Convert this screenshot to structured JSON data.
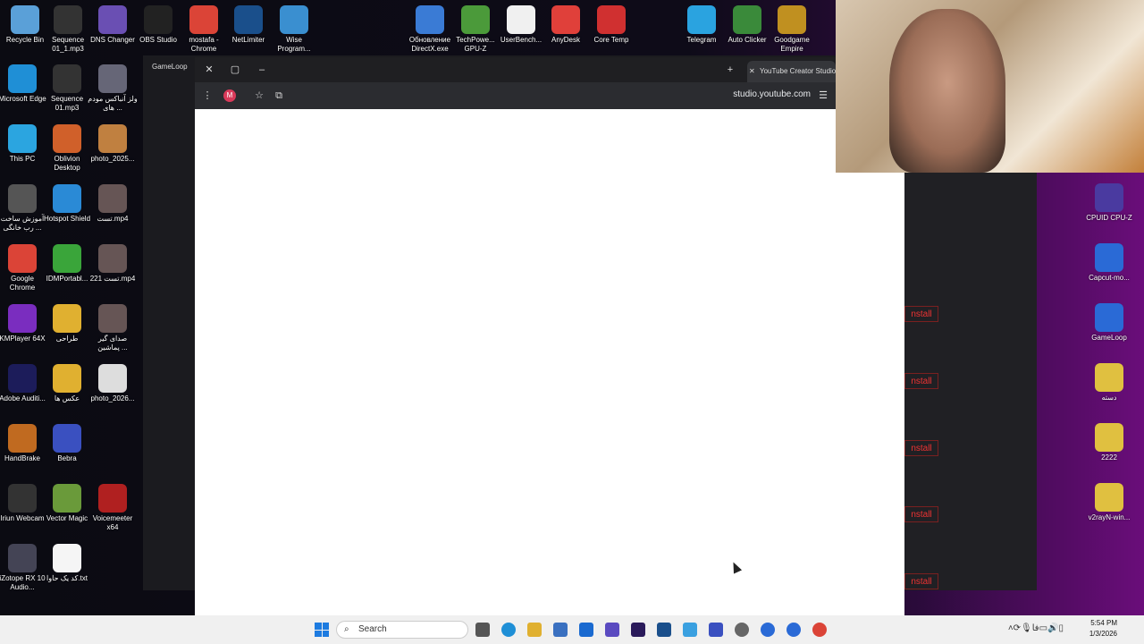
{
  "desktop_icons_left": [
    {
      "label": "Recycle Bin",
      "x": 0,
      "y": 0,
      "color": "#5aa0d8",
      "icon": "recycle-bin-icon"
    },
    {
      "label": "Sequence 01_1.mp3",
      "color": "#333",
      "icon": "media-file-icon"
    },
    {
      "label": "DNS Changer",
      "color": "#6a4fb3",
      "icon": "dns-icon"
    },
    {
      "label": "OBS Studio",
      "color": "#222",
      "icon": "obs-icon"
    },
    {
      "label": "mostafa - Chrome",
      "color": "#db4437",
      "icon": "chrome-icon"
    },
    {
      "label": "NetLimiter",
      "color": "#1a4f8b",
      "icon": "netlimiter-icon"
    },
    {
      "label": "Wise Program...",
      "color": "#3a8fd0",
      "icon": "wise-icon"
    }
  ],
  "desktop_icons_top_middle": [
    {
      "label": "Обновление DirectX.exe",
      "color": "#3a7bd5",
      "icon": "directx-icon"
    },
    {
      "label": "TechPowe... GPU-Z",
      "color": "#4b9a3a",
      "icon": "gpuz-icon"
    },
    {
      "label": "UserBench...",
      "color": "#f0f0f0",
      "icon": "userbench-icon"
    },
    {
      "label": "AnyDesk",
      "color": "#e0403a",
      "icon": "anydesk-icon"
    },
    {
      "label": "Core Temp",
      "color": "#d03030",
      "icon": "coretemp-icon"
    },
    {
      "label": "Telegram",
      "color": "#2aa3e0",
      "icon": "telegram-icon"
    },
    {
      "label": "Auto Clicker",
      "color": "#3a8a3a",
      "icon": "autoclicker-icon"
    },
    {
      "label": "Goodgame Empire",
      "color": "#c09020",
      "icon": "goodgame-icon"
    }
  ],
  "desktop_col1": [
    {
      "label": "Microsoft Edge",
      "color": "#1f8fd6",
      "icon": "edge-icon"
    },
    {
      "label": "This PC",
      "color": "#2ba5e0",
      "icon": "this-pc-icon"
    },
    {
      "label": "آموزش ساخت رب خانگی ...",
      "color": "#555",
      "icon": "video-file-icon"
    },
    {
      "label": "Google Chrome",
      "color": "#db4437",
      "icon": "chrome-icon"
    },
    {
      "label": "KMPlayer 64X",
      "color": "#7a2dbf",
      "icon": "kmplayer-icon"
    },
    {
      "label": "Adobe Auditi...",
      "color": "#1c1c5a",
      "icon": "audition-icon"
    },
    {
      "label": "HandBrake",
      "color": "#c06a20",
      "icon": "handbrake-icon"
    },
    {
      "label": "Iriun Webcam",
      "color": "#333",
      "icon": "iriun-icon"
    },
    {
      "label": "iZotope RX 10 Audio...",
      "color": "#445",
      "icon": "izotope-icon"
    }
  ],
  "desktop_col2": [
    {
      "label": "Sequence 01.mp3",
      "color": "#333",
      "icon": "media-file-icon"
    },
    {
      "label": "Oblivion Desktop",
      "color": "#d0602a",
      "icon": "oblivion-icon"
    },
    {
      "label": "Hotspot Shield",
      "color": "#2a8ad6",
      "icon": "hotspot-icon"
    },
    {
      "label": "IDMPortabl...",
      "color": "#3aa53a",
      "icon": "idm-icon"
    },
    {
      "label": "طراحی",
      "color": "#e0b030",
      "icon": "folder-icon"
    },
    {
      "label": "عکس ها",
      "color": "#e0b030",
      "icon": "folder-icon"
    },
    {
      "label": "Bebra",
      "color": "#3a50c0",
      "icon": "bebra-icon"
    },
    {
      "label": "Vector Magic",
      "color": "#6a9a3a",
      "icon": "vectormagic-icon"
    },
    {
      "label": "کد یک حاوا.txt",
      "color": "#f5f5f5",
      "icon": "text-file-icon"
    }
  ],
  "desktop_col3": [
    {
      "label": "ولز آنباکس مودم های ...",
      "color": "#667",
      "icon": "image-file-icon"
    },
    {
      "label": "photo_2025...",
      "color": "#c08040",
      "icon": "image-file-icon"
    },
    {
      "label": "تست.mp4",
      "color": "#655",
      "icon": "video-file-icon"
    },
    {
      "label": "تست 221.mp4",
      "color": "#655",
      "icon": "video-file-icon"
    },
    {
      "label": "صدای گیر پماشین ...",
      "color": "#655",
      "icon": "audio-file-icon"
    },
    {
      "label": "photo_2026...",
      "color": "#ddd",
      "icon": "image-file-icon"
    },
    {
      "label": "",
      "color": "transparent",
      "icon": "blank-icon"
    },
    {
      "label": "Voicemeeter x64",
      "color": "#b02020",
      "icon": "voicemeeter-icon"
    }
  ],
  "desktop_icons_right": [
    {
      "label": "CPUID CPU-Z",
      "color": "#4a3aa0",
      "icon": "cpuz-icon"
    },
    {
      "label": "Capcut-mo...",
      "color": "#2a6ad6",
      "icon": "capcut-icon"
    },
    {
      "label": "GameLoop",
      "color": "#2a6ad6",
      "icon": "gameloop-icon"
    },
    {
      "label": "دسته",
      "color": "#e0c040",
      "icon": "folder-icon"
    },
    {
      "label": "2222",
      "color": "#e0c040",
      "icon": "folder-icon"
    },
    {
      "label": "v2rayN-win...",
      "color": "#e0c040",
      "icon": "folder-icon"
    }
  ],
  "bg_app": {
    "title": "GameLoop",
    "install_label": "nstall"
  },
  "browser": {
    "tab_title": "YouTube Creator Studio",
    "url": "studio.youtube.com",
    "avatar_letter": "M"
  },
  "taskbar": {
    "search_placeholder": "Search",
    "time": "5:54 PM",
    "date": "1/3/2026",
    "lang": "فا"
  }
}
